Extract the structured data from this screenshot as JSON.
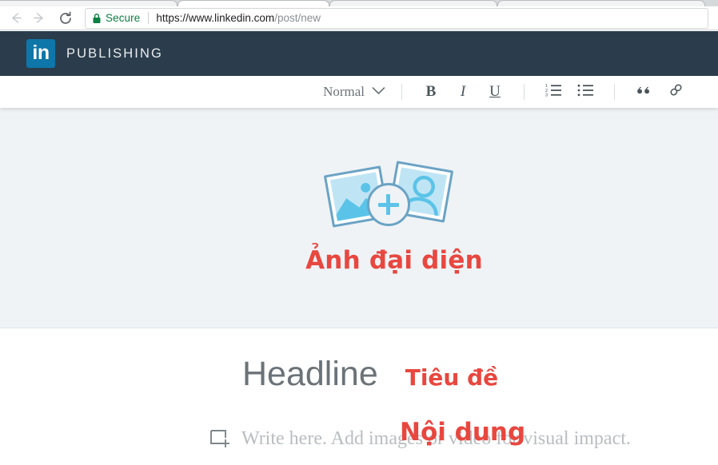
{
  "browser": {
    "back_icon": "arrow-left-icon",
    "forward_icon": "arrow-right-icon",
    "reload_icon": "reload-icon",
    "security_label": "Secure",
    "lock_icon": "lock-icon",
    "url_domain": "https://www.linkedin.com",
    "url_path": "/post/new",
    "url_full": "https://www.linkedin.com/post/new",
    "tab_count": 4
  },
  "header": {
    "logo_text": "in",
    "logo_name": "linkedin-logo",
    "title": "PUBLISHING",
    "background_color": "#2b3d4c",
    "logo_color": "#0e76a8"
  },
  "toolbar": {
    "style_label": "Normal",
    "chevron_icon": "chevron-down-icon",
    "bold_label": "B",
    "italic_label": "I",
    "underline_label": "U",
    "ordered_list_icon": "ordered-list-icon",
    "bullet_list_icon": "bullet-list-icon",
    "quote_label": "”",
    "link_icon": "link-icon"
  },
  "cover": {
    "graphic_name": "add-cover-image-graphic",
    "plus_icon": "plus-icon",
    "left_card_icon": "photo-landscape-icon",
    "right_card_icon": "photo-person-icon",
    "annotation": "Ảnh đại diện",
    "background_color": "#eff3f6",
    "accent_color": "#6ba3c4",
    "fill_color": "#bfe5f5"
  },
  "post": {
    "headline_placeholder": "Headline",
    "headline_annotation": "Tiêu đề",
    "body_icon": "add-media-icon",
    "body_placeholder": "Write here. Add images or video for visual impact.",
    "body_annotation": "Nội dung"
  },
  "annotation_color": "#e8473f"
}
